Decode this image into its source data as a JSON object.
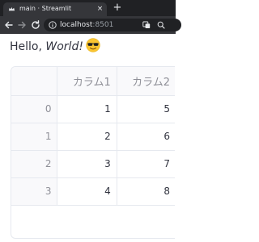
{
  "browser": {
    "tab": {
      "title": "main · Streamlit",
      "close_glyph": "×",
      "favicon": "streamlit-crown-icon"
    },
    "new_tab_glyph": "+",
    "toolbar": {
      "back_icon": "arrow-left-icon",
      "forward_icon": "arrow-right-icon",
      "reload_icon": "reload-icon",
      "url_host": "localhost",
      "url_port": ":8501",
      "site_info_icon": "info-icon",
      "translate_icon": "translate-icon",
      "zoom_icon": "zoom-icon"
    },
    "colors": {
      "tabstrip": "#202124",
      "toolbar": "#35363a",
      "text": "#e8eaed"
    }
  },
  "page": {
    "greeting": {
      "prefix": "Hello, ",
      "emphasis": "World!",
      "emoji": "sunglasses-emoji"
    },
    "dataframe": {
      "columns": [
        "",
        "カラム1",
        "カラム2"
      ],
      "rows": [
        {
          "index": "0",
          "c1": "1",
          "c2": "5"
        },
        {
          "index": "1",
          "c1": "2",
          "c2": "6"
        },
        {
          "index": "2",
          "c1": "3",
          "c2": "7"
        },
        {
          "index": "3",
          "c1": "4",
          "c2": "8"
        }
      ]
    },
    "colors": {
      "text": "#31333f",
      "muted": "#8f9098",
      "border": "#e6e9ef",
      "header_bg": "#f9f9fb"
    }
  }
}
